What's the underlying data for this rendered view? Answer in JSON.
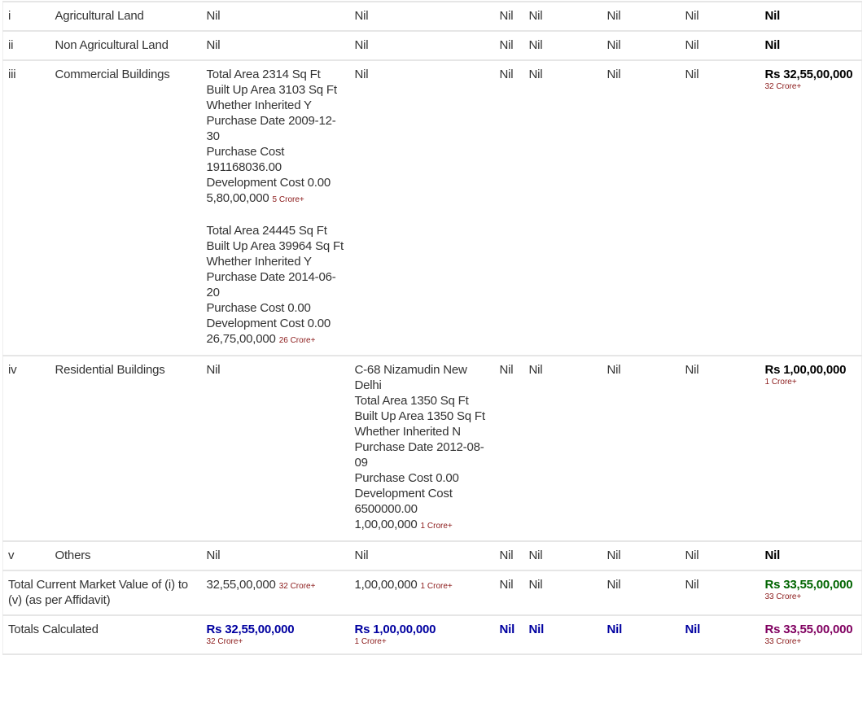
{
  "rows": [
    {
      "no": "i",
      "desc": "Agricultural Land",
      "c1": "Nil",
      "c2": "Nil",
      "c3": "Nil",
      "c4": "Nil",
      "c5": "Nil",
      "c6": "Nil",
      "total": "Nil",
      "total_sub": ""
    },
    {
      "no": "ii",
      "desc": "Non Agricultural Land",
      "c1": "Nil",
      "c2": "Nil",
      "c3": "Nil",
      "c4": "Nil",
      "c5": "Nil",
      "c6": "Nil",
      "total": "Nil",
      "total_sub": ""
    },
    {
      "no": "iii",
      "desc": "Commercial Buildings",
      "c2": "Nil",
      "c3": "Nil",
      "c4": "Nil",
      "c5": "Nil",
      "c6": "Nil",
      "total": "Rs 32,55,00,000",
      "total_sub": "32 Crore+",
      "c1_entries": [
        {
          "lines": [
            "Total Area 2314 Sq Ft",
            "Built Up Area 3103 Sq Ft",
            "Whether Inherited Y",
            "Purchase Date 2009-12-30",
            "Purchase Cost 191168036.00",
            "Development Cost 0.00"
          ],
          "value": "5,80,00,000",
          "value_sub": "5 Crore+"
        },
        {
          "lines": [
            "Total Area 24445 Sq Ft",
            "Built Up Area 39964 Sq Ft",
            "Whether Inherited Y",
            "Purchase Date 2014-06-20",
            "Purchase Cost 0.00",
            "Development Cost 0.00"
          ],
          "value": "26,75,00,000",
          "value_sub": "26 Crore+"
        }
      ]
    },
    {
      "no": "iv",
      "desc": "Residential Buildings",
      "c1": "Nil",
      "c3": "Nil",
      "c4": "Nil",
      "c5": "Nil",
      "c6": "Nil",
      "total": "Rs 1,00,00,000",
      "total_sub": "1 Crore+",
      "c2_entries": [
        {
          "lines": [
            "C-68 Nizamudin New Delhi",
            "Total Area 1350 Sq Ft",
            "Built Up Area 1350 Sq Ft",
            "Whether Inherited N",
            "Purchase Date 2012-08-09",
            "Purchase Cost 0.00",
            "Development Cost 6500000.00"
          ],
          "value": "1,00,00,000",
          "value_sub": "1 Crore+"
        }
      ]
    },
    {
      "no": "v",
      "desc": "Others",
      "c1": "Nil",
      "c2": "Nil",
      "c3": "Nil",
      "c4": "Nil",
      "c5": "Nil",
      "c6": "Nil",
      "total": "Nil",
      "total_sub": ""
    }
  ],
  "affidavit": {
    "label": "Total Current Market Value of (i) to (v) (as per Affidavit)",
    "c1": "32,55,00,000",
    "c1_sub": "32 Crore+",
    "c2": "1,00,00,000",
    "c2_sub": "1 Crore+",
    "c3": "Nil",
    "c4": "Nil",
    "c5": "Nil",
    "c6": "Nil",
    "total": "Rs 33,55,00,000",
    "total_sub": "33 Crore+"
  },
  "calculated": {
    "label": "Totals Calculated",
    "c1": "Rs 32,55,00,000",
    "c1_sub": "32 Crore+",
    "c2": "Rs 1,00,00,000",
    "c2_sub": "1 Crore+",
    "c3": "Nil",
    "c4": "Nil",
    "c5": "Nil",
    "c6": "Nil",
    "total": "Rs 33,55,00,000",
    "total_sub": "33 Crore+"
  },
  "colors": {
    "calculated": "#0000a0",
    "affidavit_total": "#006400",
    "calculated_total": "#800060",
    "crore_note": "#8b1a1a"
  }
}
